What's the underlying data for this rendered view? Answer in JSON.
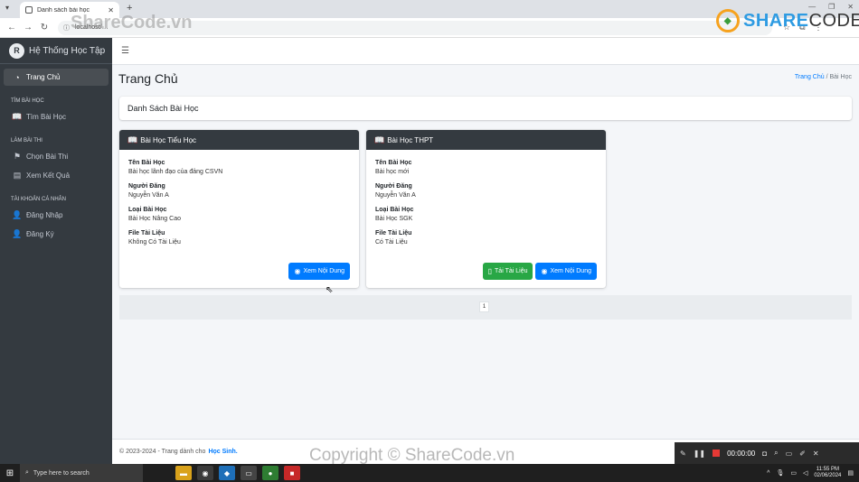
{
  "browser": {
    "tab_title": "Danh sách bài học",
    "new_tab": "+",
    "url": "localhost/…"
  },
  "sidebar": {
    "brand": "Hệ Thống Học Tập",
    "brand_logo": "R",
    "items": [
      {
        "label": "Trang Chủ",
        "icon": "dashboard-icon"
      },
      {
        "header": "TÌM BÀI HỌC"
      },
      {
        "label": "Tìm Bài Học",
        "icon": "book-icon"
      },
      {
        "header": "LÀM BÀI THI"
      },
      {
        "label": "Chọn Bài Thi",
        "icon": "signpost-icon"
      },
      {
        "label": "Xem Kết Quả",
        "icon": "chart-icon"
      },
      {
        "header": "TÀI KHOẢN CÁ NHÂN"
      },
      {
        "label": "Đăng Nhập",
        "icon": "user-icon"
      },
      {
        "label": "Đăng Ký",
        "icon": "user-plus-icon"
      }
    ]
  },
  "page": {
    "title": "Trang Chủ",
    "breadcrumb_home": "Trang Chủ",
    "breadcrumb_sep": "/",
    "breadcrumb_current": "Bài Học",
    "list_title": "Danh Sách Bài Học"
  },
  "lessons": [
    {
      "header": "Bài Học Tiểu Học",
      "name_label": "Tên Bài Học",
      "name": "Bài học lãnh đạo của đảng CSVN",
      "author_label": "Người Đăng",
      "author": "Nguyễn Văn A",
      "type_label": "Loại Bài Học",
      "type": "Bài Học Nâng Cao",
      "file_label": "File Tài Liệu",
      "file": "Không Có Tài Liệu",
      "view_button": "Xem Nội Dung"
    },
    {
      "header": "Bài Học THPT",
      "name_label": "Tên Bài Học",
      "name": "Bài học mới",
      "author_label": "Người Đăng",
      "author": "Nguyễn Văn A",
      "type_label": "Loại Bài Học",
      "type": "Bài Học SGK",
      "file_label": "File Tài Liệu",
      "file": "Có Tài Liệu",
      "download_button": "Tải Tài Liệu",
      "view_button": "Xem Nội Dung"
    }
  ],
  "pagination": {
    "current": "1"
  },
  "footer": {
    "text": "© 2023-2024 - Trang dành cho",
    "link": "Học Sinh."
  },
  "recorder": {
    "time": "00:00:00"
  },
  "taskbar": {
    "search_placeholder": "Type here to search",
    "time": "11:55 PM",
    "date": "02/06/2024"
  },
  "watermark": {
    "logo_share": "SHARE",
    "logo_code": "CODE.vn",
    "top": "ShareCode.vn",
    "bottom": "Copyright © ShareCode.vn"
  },
  "colors": {
    "sidebar": "#343a40",
    "primary": "#007bff",
    "success": "#28a745",
    "content_bg": "#f4f6f9"
  }
}
